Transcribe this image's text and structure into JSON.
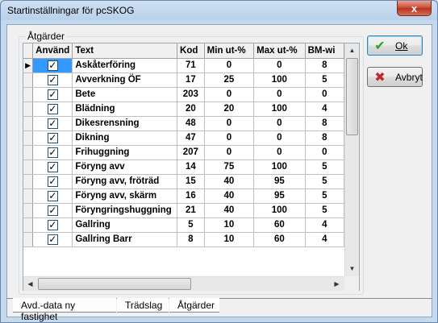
{
  "window": {
    "title": "Startinställningar för pcSKOG",
    "close_glyph": "x"
  },
  "group": {
    "label": "Åtgärder"
  },
  "table": {
    "headers": [
      "Använd",
      "Text",
      "Kod",
      "Min ut-%",
      "Max ut-%",
      "BM-wi"
    ],
    "rows": [
      {
        "text": "Askåterföring",
        "kod": "71",
        "min": "0",
        "max": "0",
        "bm": "8",
        "checked": true,
        "current": true
      },
      {
        "text": "Avverkning ÖF",
        "kod": "17",
        "min": "25",
        "max": "100",
        "bm": "5",
        "checked": true
      },
      {
        "text": "Bete",
        "kod": "203",
        "min": "0",
        "max": "0",
        "bm": "0",
        "checked": true
      },
      {
        "text": "Blädning",
        "kod": "20",
        "min": "20",
        "max": "100",
        "bm": "4",
        "checked": true
      },
      {
        "text": "Dikesrensning",
        "kod": "48",
        "min": "0",
        "max": "0",
        "bm": "8",
        "checked": true
      },
      {
        "text": "Dikning",
        "kod": "47",
        "min": "0",
        "max": "0",
        "bm": "8",
        "checked": true
      },
      {
        "text": "Frihuggning",
        "kod": "207",
        "min": "0",
        "max": "0",
        "bm": "0",
        "checked": true
      },
      {
        "text": "Föryng avv",
        "kod": "14",
        "min": "75",
        "max": "100",
        "bm": "5",
        "checked": true
      },
      {
        "text": "Föryng avv, fröträd",
        "kod": "15",
        "min": "40",
        "max": "95",
        "bm": "5",
        "checked": true
      },
      {
        "text": "Föryng avv, skärm",
        "kod": "16",
        "min": "40",
        "max": "95",
        "bm": "5",
        "checked": true
      },
      {
        "text": "Föryngringshuggning",
        "kod": "21",
        "min": "40",
        "max": "100",
        "bm": "5",
        "checked": true
      },
      {
        "text": "Gallring",
        "kod": "5",
        "min": "10",
        "max": "60",
        "bm": "4",
        "checked": true
      },
      {
        "text": "Gallring Barr",
        "kod": "8",
        "min": "10",
        "max": "60",
        "bm": "4",
        "checked": true
      }
    ],
    "row_indicator": "▶",
    "check_glyph": "✓"
  },
  "buttons": {
    "ok": {
      "label": "Ok",
      "icon": "checkmark-icon",
      "icon_glyph": "✔",
      "icon_color": "#2e9e2e"
    },
    "cancel": {
      "label": "Avbryt",
      "icon": "x-icon",
      "icon_glyph": "✖",
      "icon_color": "#c0282d"
    }
  },
  "tabs": [
    {
      "label": "Avd.-data ny fastighet",
      "active": false
    },
    {
      "label": "Trädslag",
      "active": false
    },
    {
      "label": "Åtgärder",
      "active": true
    }
  ],
  "scroll_arrows": {
    "up": "▲",
    "down": "▼",
    "left": "◀",
    "right": "▶"
  }
}
